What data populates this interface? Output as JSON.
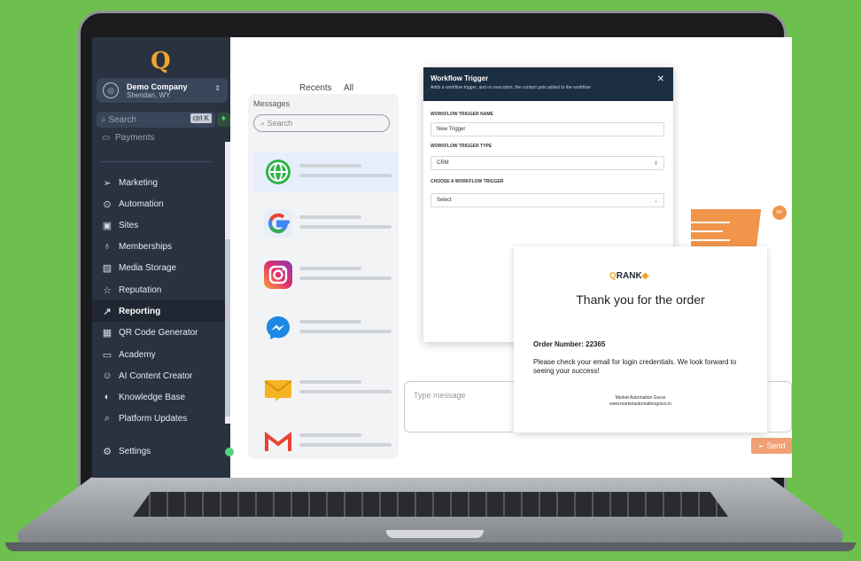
{
  "sidebar": {
    "company_name": "Demo Company",
    "company_location": "Sheridan, WY",
    "search_placeholder": "Search",
    "search_shortcut": "ctrl K",
    "partial_item": "Payments",
    "items": [
      {
        "label": "Marketing",
        "icon": "send-icon"
      },
      {
        "label": "Automation",
        "icon": "play-circle-icon"
      },
      {
        "label": "Sites",
        "icon": "browser-icon"
      },
      {
        "label": "Memberships",
        "icon": "award-icon"
      },
      {
        "label": "Media Storage",
        "icon": "image-icon"
      },
      {
        "label": "Reputation",
        "icon": "star-icon"
      },
      {
        "label": "Reporting",
        "icon": "chart-line-icon",
        "active": true
      },
      {
        "label": "QR Code Generator",
        "icon": "qr-icon"
      },
      {
        "label": "Academy",
        "icon": "monitor-icon"
      },
      {
        "label": "AI Content Creator",
        "icon": "robot-icon"
      },
      {
        "label": "Knowledge Base",
        "icon": "brain-icon"
      },
      {
        "label": "Platform Updates",
        "icon": "search-icon"
      }
    ],
    "settings_label": "Settings"
  },
  "messages": {
    "tab_recents": "Recents",
    "tab_all": "All",
    "title": "Messages",
    "search_placeholder": "Search",
    "channels": [
      "globe-icon",
      "google-icon",
      "instagram-icon",
      "messenger-icon",
      "email-icon",
      "gmail-icon"
    ],
    "type_placeholder": "Type message",
    "send_label": "Send"
  },
  "workflow": {
    "title": "Workflow Trigger",
    "subtitle": "Adds a workflow trigger, and on execution, the contact gets added to the workflow",
    "name_label": "WORKFLOW TRIGGER NAME",
    "name_value": "New Trigger",
    "type_label": "WORKFLOW TRIGGER TYPE",
    "type_value": "CRM",
    "choose_label": "CHOOSE A WORKFLOW TRIGGER",
    "choose_value": "Select"
  },
  "order": {
    "brand_q": "Q",
    "brand_rest": "RANK",
    "thanks": "Thank you for the order",
    "order_number": "Order Number: 22365",
    "message": "Please check your email for login credentials. We look forward to seeing your success!",
    "footer_name": "Market Automation Gurus",
    "footer_url": "www.marketautomationgurus.io"
  },
  "badge": "RP",
  "colors": {
    "background": "#6ec04e",
    "sidebar": "#293241",
    "accent": "#f0954a",
    "modal_header": "#1c2f42"
  }
}
